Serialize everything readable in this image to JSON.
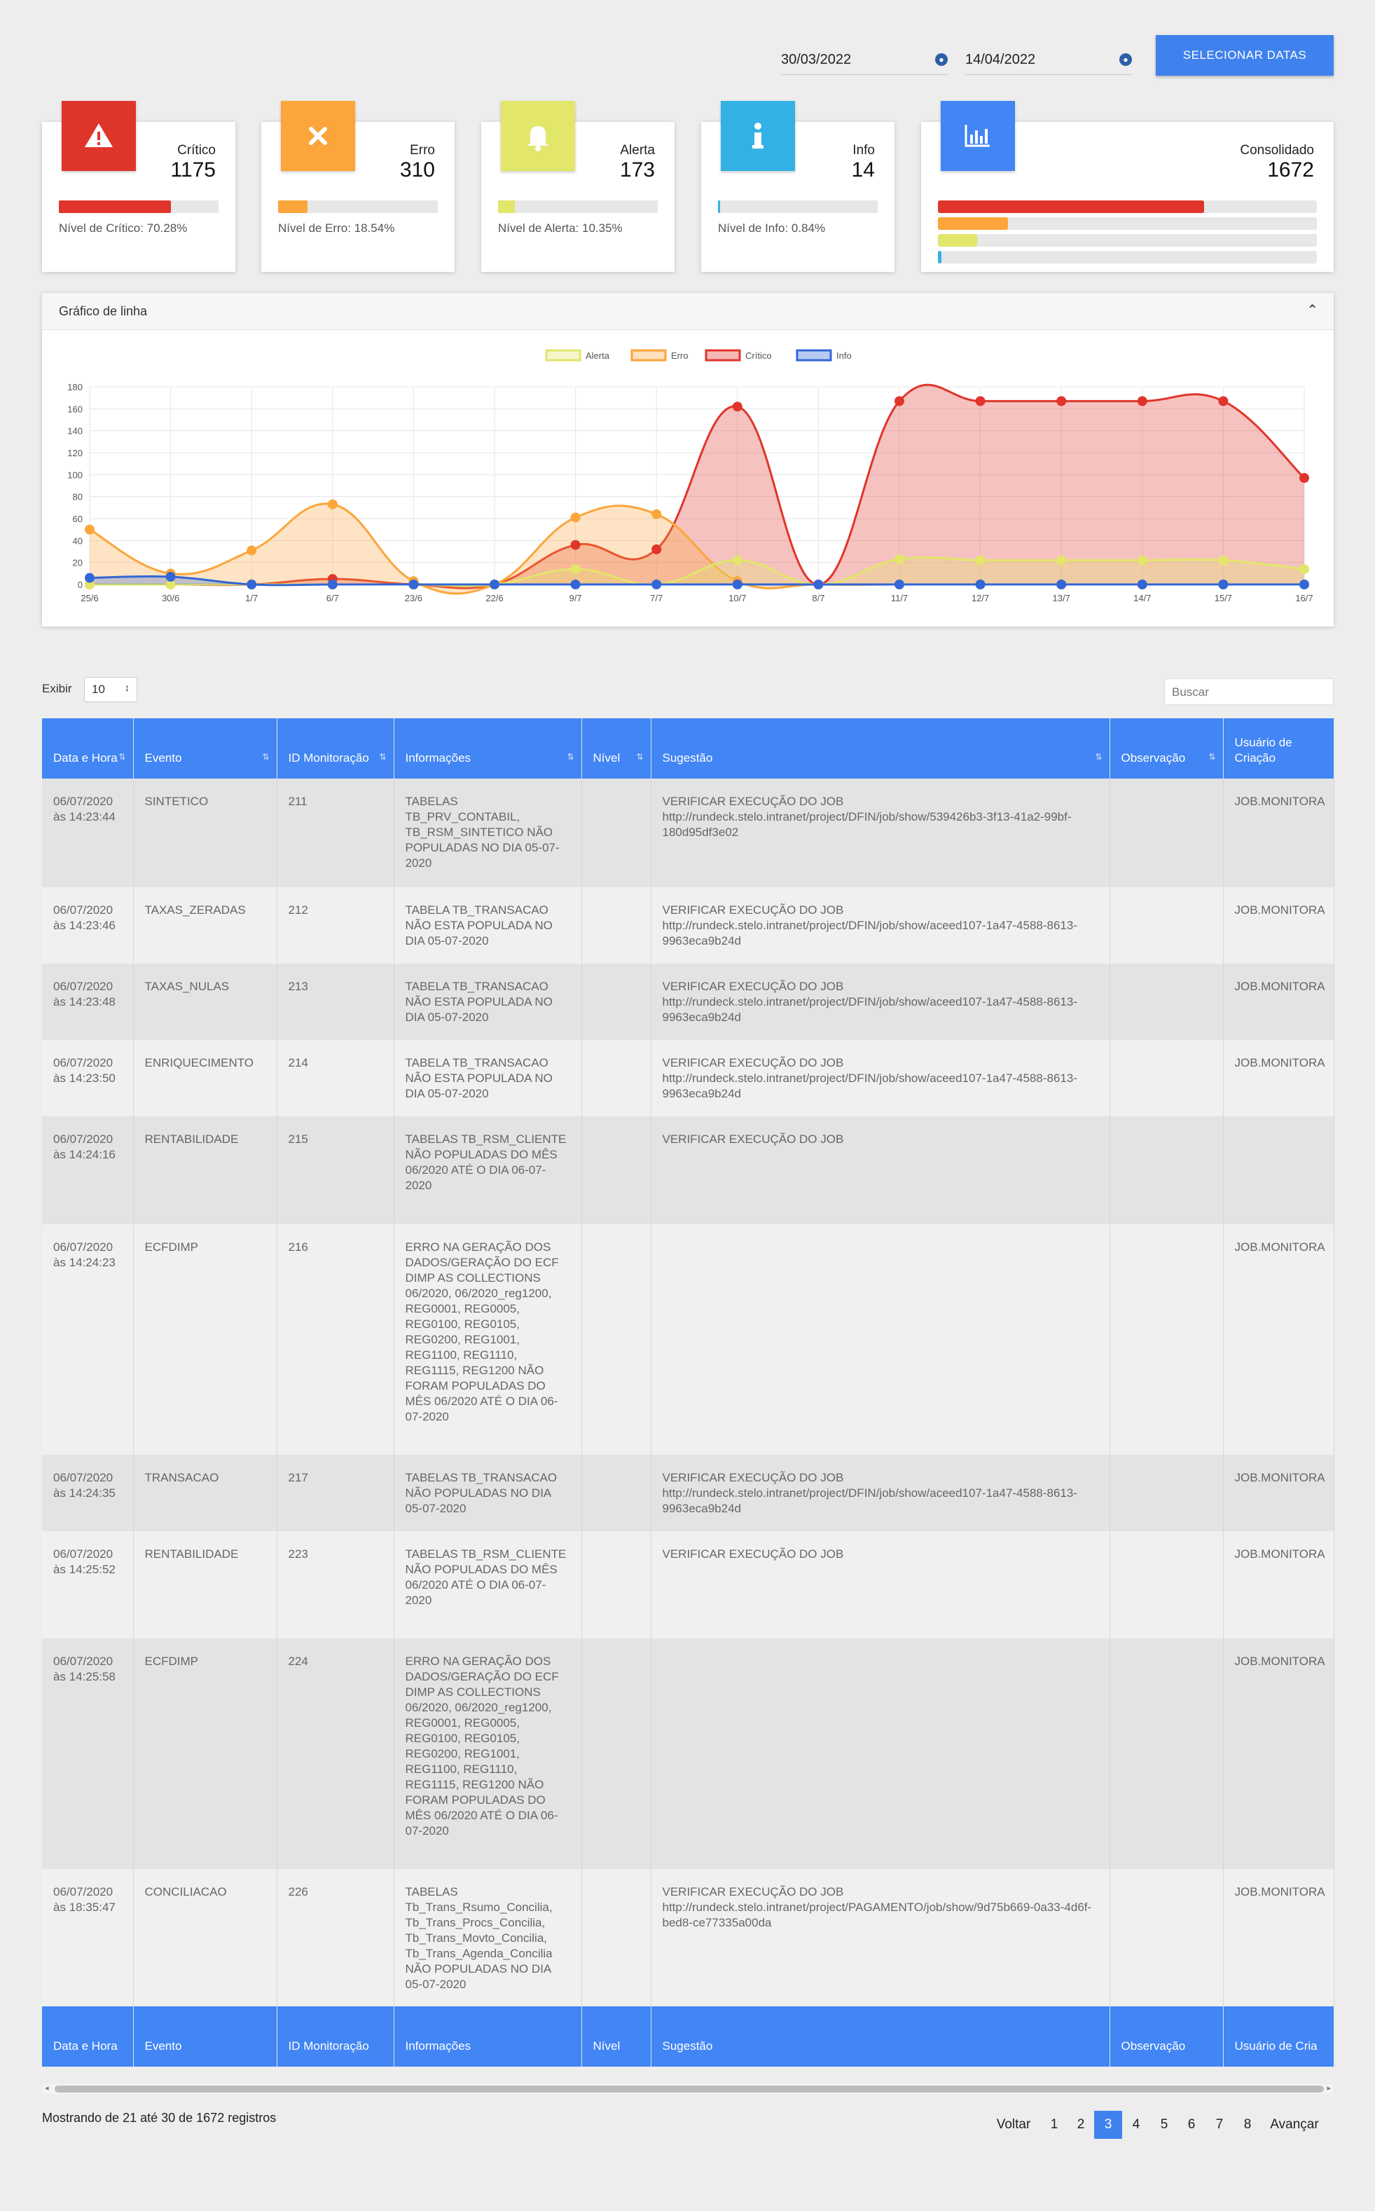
{
  "date_filter": {
    "start": "30/03/2022",
    "end": "14/04/2022",
    "button_label": "SELECIONAR DATAS"
  },
  "cards": [
    {
      "label": "Crítico",
      "count": "1175",
      "level": "Nível de Crítico: 70.28%",
      "percent": 70.28,
      "color": "#e0352b",
      "icon": "warning-triangle-icon"
    },
    {
      "label": "Erro",
      "count": "310",
      "level": "Nível de Erro: 18.54%",
      "percent": 18.54,
      "color": "#fba53a",
      "icon": "x-icon"
    },
    {
      "label": "Alerta",
      "count": "173",
      "level": "Nível de Alerta: 10.35%",
      "percent": 10.35,
      "color": "#e2e66a",
      "icon": "bell-icon"
    },
    {
      "label": "Info",
      "count": "14",
      "level": "Nível de Info: 0.84%",
      "percent": 0.84,
      "color": "#33b1e4",
      "icon": "info-icon"
    }
  ],
  "consolidated": {
    "label": "Consolidado",
    "count": "1672",
    "icon": "bar-chart-icon",
    "color": "#4285f4"
  },
  "chart_panel": {
    "title": "Gráfico de linha",
    "collapse_icon": "chevron-up-icon"
  },
  "chart_data": {
    "type": "area",
    "categories": [
      "25/6",
      "30/6",
      "1/7",
      "6/7",
      "23/6",
      "22/6",
      "9/7",
      "7/7",
      "10/7",
      "8/7",
      "11/7",
      "12/7",
      "13/7",
      "14/7",
      "15/7",
      "16/7"
    ],
    "series": [
      {
        "name": "Alerta",
        "color": "#e2e66a",
        "values": [
          0,
          0,
          0,
          0,
          0,
          0,
          14,
          0,
          22,
          0,
          23,
          22,
          22,
          22,
          22,
          14
        ]
      },
      {
        "name": "Erro",
        "color": "#fba53a",
        "values": [
          50,
          10,
          31,
          73,
          3,
          0,
          61,
          64,
          3,
          0,
          0,
          0,
          0,
          0,
          0,
          0
        ]
      },
      {
        "name": "Crítico",
        "color": "#e0352b",
        "values": [
          0,
          0,
          0,
          5,
          0,
          0,
          36,
          32,
          162,
          0,
          167,
          167,
          167,
          167,
          167,
          97
        ]
      },
      {
        "name": "Info",
        "color": "#3366d6",
        "values": [
          6,
          7,
          0,
          0,
          0,
          0,
          0,
          0,
          0,
          0,
          0,
          0,
          0,
          0,
          0,
          0
        ]
      }
    ],
    "ylim": [
      0,
      180
    ],
    "yticks": [
      "0",
      "20",
      "40",
      "60",
      "80",
      "100",
      "120",
      "140",
      "160",
      "180"
    ],
    "grid": true,
    "legend": "top-center"
  },
  "table_controls": {
    "show_label": "Exibir",
    "page_length": "10",
    "search_placeholder": "Buscar"
  },
  "table": {
    "columns": [
      "Data e Hora",
      "Evento",
      "ID Monitoração",
      "Informações",
      "Nível",
      "Sugestão",
      "Observação",
      "Usuário de Criação"
    ],
    "rows": [
      {
        "date": "06/07/2020 às 14:23:44",
        "event": "SINTETICO",
        "id": "211",
        "info": "TABELAS TB_PRV_CONTABIL, TB_RSM_SINTETICO NÃO POPULADAS NO DIA 05-07-2020",
        "level": "",
        "suggestion": "VERIFICAR EXECUÇÃO DO JOB http://rundeck.stelo.intranet/project/DFIN/job/show/539426b3-3f13-41a2-99bf-180d95df3e02",
        "note": "",
        "user": "JOB.MONITORA"
      },
      {
        "date": "06/07/2020 às 14:23:46",
        "event": "TAXAS_ZERADAS",
        "id": "212",
        "info": "TABELA TB_TRANSACAO NÃO ESTA POPULADA NO DIA 05-07-2020",
        "level": "",
        "suggestion": "VERIFICAR EXECUÇÃO DO JOB http://rundeck.stelo.intranet/project/DFIN/job/show/aceed107-1a47-4588-8613-9963eca9b24d",
        "note": "",
        "user": "JOB.MONITORA"
      },
      {
        "date": "06/07/2020 às 14:23:48",
        "event": "TAXAS_NULAS",
        "id": "213",
        "info": "TABELA TB_TRANSACAO NÃO ESTA POPULADA NO DIA 05-07-2020",
        "level": "",
        "suggestion": "VERIFICAR EXECUÇÃO DO JOB http://rundeck.stelo.intranet/project/DFIN/job/show/aceed107-1a47-4588-8613-9963eca9b24d",
        "note": "",
        "user": "JOB.MONITORA"
      },
      {
        "date": "06/07/2020 às 14:23:50",
        "event": "ENRIQUECIMENTO",
        "id": "214",
        "info": "TABELA TB_TRANSACAO NÃO ESTA POPULADA NO DIA 05-07-2020",
        "level": "",
        "suggestion": "VERIFICAR EXECUÇÃO DO JOB http://rundeck.stelo.intranet/project/DFIN/job/show/aceed107-1a47-4588-8613-9963eca9b24d",
        "note": "",
        "user": "JOB.MONITORA"
      },
      {
        "date": "06/07/2020 às 14:24:16",
        "event": "RENTABILIDADE",
        "id": "215",
        "info": "TABELAS TB_RSM_CLIENTE NÃO POPULADAS DO MÊS 06/2020 ATÉ O DIA 06-07-2020",
        "level": "",
        "suggestion": "VERIFICAR EXECUÇÃO DO JOB",
        "note": "",
        "user": ""
      },
      {
        "date": "06/07/2020 às 14:24:23",
        "event": "ECFDIMP",
        "id": "216",
        "info": "ERRO NA GERAÇÃO DOS DADOS/GERAÇÃO DO ECF DIMP AS COLLECTIONS 06/2020, 06/2020_reg1200, REG0001, REG0005, REG0100, REG0105, REG0200, REG1001, REG1100, REG1110, REG1115, REG1200 NÃO FORAM POPULADAS DO MÊS 06/2020 ATÉ O DIA 06-07-2020",
        "level": "",
        "suggestion": "",
        "note": "",
        "user": "JOB.MONITORA"
      },
      {
        "date": "06/07/2020 às 14:24:35",
        "event": "TRANSACAO",
        "id": "217",
        "info": "TABELAS TB_TRANSACAO NÃO POPULADAS NO DIA 05-07-2020",
        "level": "",
        "suggestion": "VERIFICAR EXECUÇÃO DO JOB http://rundeck.stelo.intranet/project/DFIN/job/show/aceed107-1a47-4588-8613-9963eca9b24d",
        "note": "",
        "user": "JOB.MONITORA"
      },
      {
        "date": "06/07/2020 às 14:25:52",
        "event": "RENTABILIDADE",
        "id": "223",
        "info": "TABELAS TB_RSM_CLIENTE NÃO POPULADAS DO MÊS 06/2020 ATÉ O DIA 06-07-2020",
        "level": "",
        "suggestion": "VERIFICAR EXECUÇÃO DO JOB",
        "note": "",
        "user": "JOB.MONITORA"
      },
      {
        "date": "06/07/2020 às 14:25:58",
        "event": "ECFDIMP",
        "id": "224",
        "info": "ERRO NA GERAÇÃO DOS DADOS/GERAÇÃO DO ECF DIMP AS COLLECTIONS 06/2020, 06/2020_reg1200, REG0001, REG0005, REG0100, REG0105, REG0200, REG1001, REG1100, REG1110, REG1115, REG1200 NÃO FORAM POPULADAS DO MÊS 06/2020 ATÉ O DIA 06-07-2020",
        "level": "",
        "suggestion": "",
        "note": "",
        "user": "JOB.MONITORA"
      },
      {
        "date": "06/07/2020 às 18:35:47",
        "event": "CONCILIACAO",
        "id": "226",
        "info": "TABELAS Tb_Trans_Rsumo_Concilia, Tb_Trans_Procs_Concilia, Tb_Trans_Movto_Concilia, Tb_Trans_Agenda_Concilia NÃO POPULADAS NO DIA 05-07-2020",
        "level": "",
        "suggestion": "VERIFICAR EXECUÇÃO DO JOB http://rundeck.stelo.intranet/project/PAGAMENTO/job/show/9d75b669-0a33-4d6f-bed8-ce77335a00da",
        "note": "",
        "user": "JOB.MONITORA"
      }
    ],
    "footer_columns": [
      "Data e Hora",
      "Evento",
      "ID Monitoração",
      "Informações",
      "Nível",
      "Sugestão",
      "Observação",
      "Usuário de Cria"
    ]
  },
  "pagination": {
    "info": "Mostrando de 21 até 30 de 1672 registros",
    "prev": "Voltar",
    "pages": [
      "1",
      "2",
      "3",
      "4",
      "5",
      "6",
      "7",
      "8"
    ],
    "current": "3",
    "next": "Avançar"
  }
}
